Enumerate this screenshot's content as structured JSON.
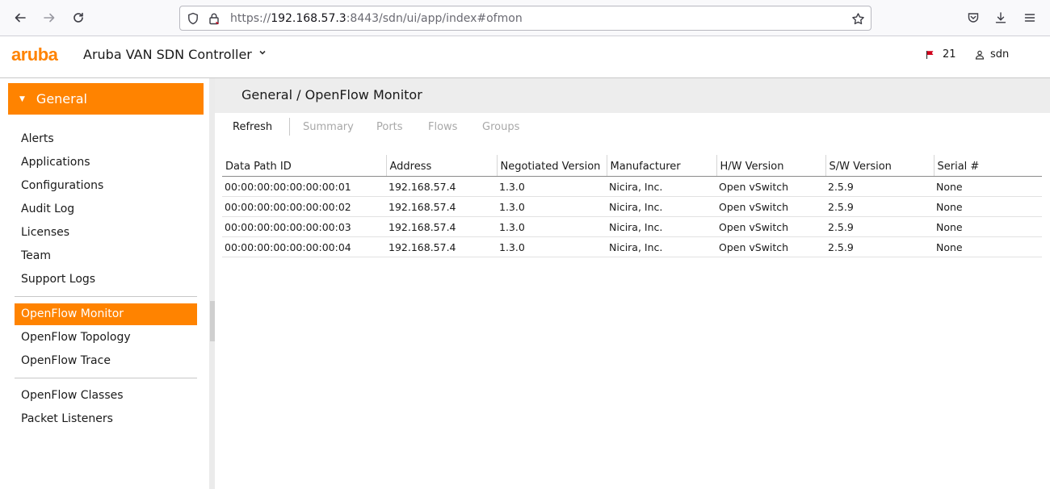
{
  "browser": {
    "url_scheme": "https://",
    "url_host": "192.168.57.3",
    "url_rest": ":8443/sdn/ui/app/index#ofmon",
    "icons": [
      "back-icon",
      "forward-icon",
      "reload-icon",
      "shield-icon",
      "lock-icon",
      "bookmark-star-icon",
      "pocket-icon",
      "download-icon",
      "menu-icon"
    ]
  },
  "header": {
    "logo": "aruba",
    "title": "Aruba VAN SDN Controller",
    "alert_count": "21",
    "user": "sdn",
    "colors": {
      "accent": "#ff8300",
      "flag": "#d0021b"
    }
  },
  "sidebar": {
    "section": "General",
    "group1": [
      "Alerts",
      "Applications",
      "Configurations",
      "Audit Log",
      "Licenses",
      "Team",
      "Support Logs"
    ],
    "group2": [
      "OpenFlow Monitor",
      "OpenFlow Topology",
      "OpenFlow Trace"
    ],
    "group3": [
      "OpenFlow Classes",
      "Packet Listeners"
    ],
    "active": "OpenFlow Monitor"
  },
  "main": {
    "title": "General / OpenFlow Monitor",
    "tabs": [
      "Refresh",
      "Summary",
      "Ports",
      "Flows",
      "Groups"
    ],
    "table": {
      "columns": [
        "Data Path ID",
        "Address",
        "Negotiated Version",
        "Manufacturer",
        "H/W Version",
        "S/W Version",
        "Serial #"
      ],
      "rows": [
        [
          "00:00:00:00:00:00:00:01",
          "192.168.57.4",
          "1.3.0",
          "Nicira, Inc.",
          "Open vSwitch",
          "2.5.9",
          "None"
        ],
        [
          "00:00:00:00:00:00:00:02",
          "192.168.57.4",
          "1.3.0",
          "Nicira, Inc.",
          "Open vSwitch",
          "2.5.9",
          "None"
        ],
        [
          "00:00:00:00:00:00:00:03",
          "192.168.57.4",
          "1.3.0",
          "Nicira, Inc.",
          "Open vSwitch",
          "2.5.9",
          "None"
        ],
        [
          "00:00:00:00:00:00:00:04",
          "192.168.57.4",
          "1.3.0",
          "Nicira, Inc.",
          "Open vSwitch",
          "2.5.9",
          "None"
        ]
      ]
    }
  }
}
